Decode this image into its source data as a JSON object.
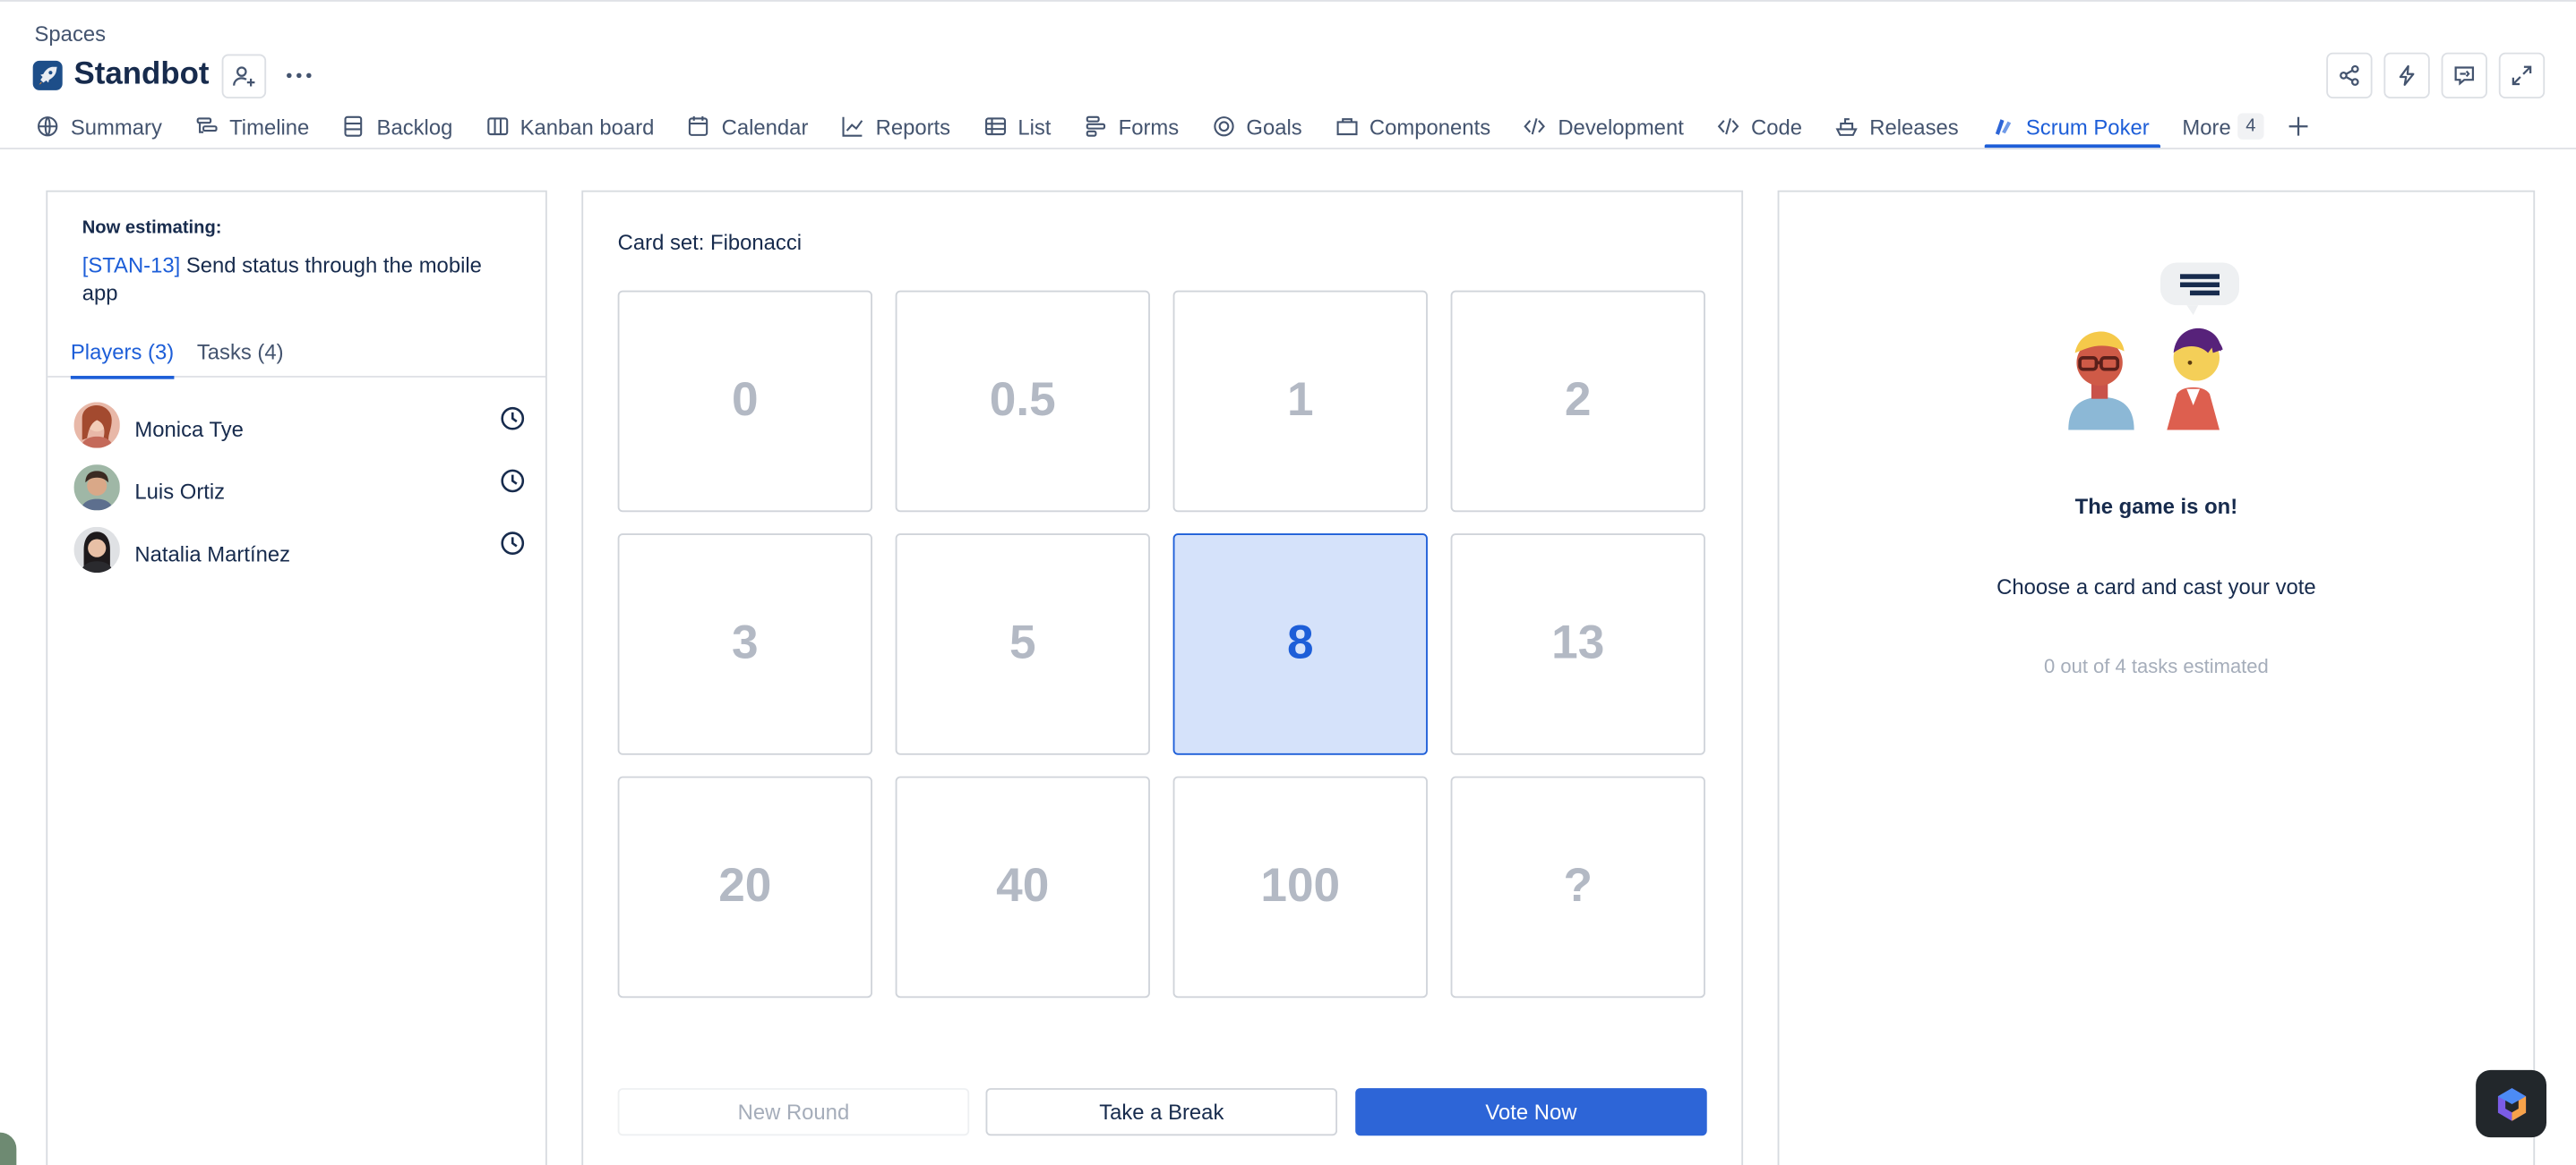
{
  "breadcrumb": "Spaces",
  "space": {
    "title": "Standbot"
  },
  "tabs": [
    {
      "label": "Summary"
    },
    {
      "label": "Timeline"
    },
    {
      "label": "Backlog"
    },
    {
      "label": "Kanban board"
    },
    {
      "label": "Calendar"
    },
    {
      "label": "Reports"
    },
    {
      "label": "List"
    },
    {
      "label": "Forms"
    },
    {
      "label": "Goals"
    },
    {
      "label": "Components"
    },
    {
      "label": "Development"
    },
    {
      "label": "Code"
    },
    {
      "label": "Releases"
    },
    {
      "label": "Scrum Poker",
      "active": true
    }
  ],
  "more": {
    "label": "More",
    "count": "4"
  },
  "estimating": {
    "label": "Now estimating:",
    "task_key": "[STAN-13]",
    "task_title": " Send status through the mobile app"
  },
  "player_tabs": {
    "players": "Players (3)",
    "tasks": "Tasks (4)"
  },
  "players": [
    {
      "name": "Monica Tye"
    },
    {
      "name": "Luis Ortiz"
    },
    {
      "name": "Natalia Martínez"
    }
  ],
  "card_set": "Card set: Fibonacci",
  "cards": [
    "0",
    "0.5",
    "1",
    "2",
    "3",
    "5",
    "8",
    "13",
    "20",
    "40",
    "100",
    "?"
  ],
  "selected_card": "8",
  "buttons": {
    "new_round": "New Round",
    "take_break": "Take a Break",
    "vote_now": "Vote Now"
  },
  "status": {
    "title": "The game is on!",
    "subtitle": "Choose a card and cast your vote",
    "progress": "0 out of 4 tasks estimated"
  },
  "colors": {
    "accent": "#1d5ed8",
    "vote_button": "#2d65d7",
    "selected_card_bg": "#d5e2fa"
  }
}
